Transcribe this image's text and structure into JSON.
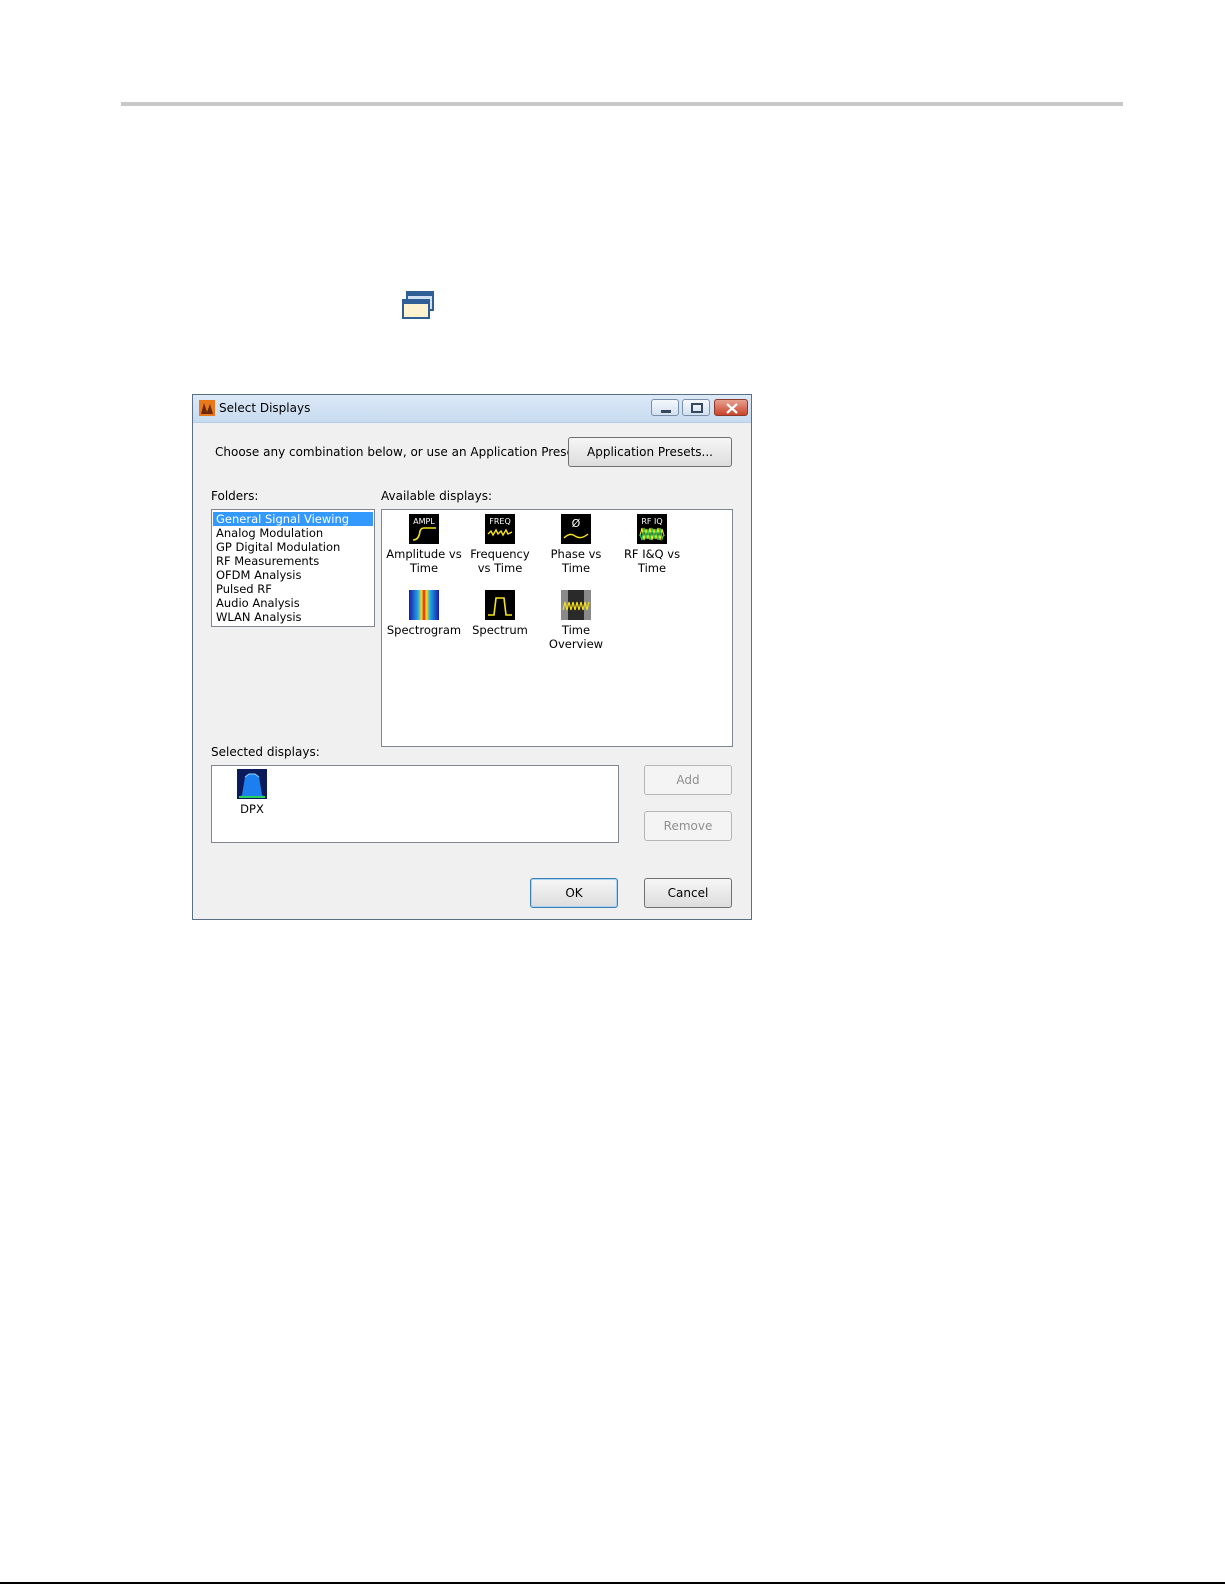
{
  "dialog": {
    "title": "Select Displays",
    "prompt": "Choose any combination below, or use an Application Preset.",
    "presets_button": "Application Presets...",
    "folders_label": "Folders:",
    "available_label": "Available displays:",
    "selected_label": "Selected displays:",
    "folders": [
      "General Signal Viewing",
      "Analog Modulation",
      "GP Digital Modulation",
      "RF Measurements",
      "OFDM Analysis",
      "Pulsed RF",
      "Audio Analysis",
      "WLAN Analysis"
    ],
    "selected_folder": "General Signal Viewing",
    "available_displays": [
      {
        "line1": "Amplitude vs",
        "line2": "Time",
        "icon": "ampl-icon",
        "icon_text": "AMPL"
      },
      {
        "line1": "Frequency",
        "line2": "vs Time",
        "icon": "freq-icon",
        "icon_text": "FREQ"
      },
      {
        "line1": "Phase vs",
        "line2": "Time",
        "icon": "phase-icon",
        "icon_text": "Ø"
      },
      {
        "line1": "RF I&Q vs",
        "line2": "Time",
        "icon": "rfiq-icon",
        "icon_text": "RF IQ"
      },
      {
        "line1": "Spectrogram",
        "line2": "",
        "icon": "spectrogram-icon",
        "icon_text": ""
      },
      {
        "line1": "Spectrum",
        "line2": "",
        "icon": "spectrum-icon",
        "icon_text": ""
      },
      {
        "line1": "Time",
        "line2": "Overview",
        "icon": "time-overview-icon",
        "icon_text": ""
      }
    ],
    "selected_displays": [
      {
        "label": "DPX",
        "icon": "dpx-icon"
      }
    ],
    "add_button": "Add",
    "remove_button": "Remove",
    "ok_button": "OK",
    "cancel_button": "Cancel"
  },
  "colors": {
    "selection": "#3399ff",
    "icon_bg": "#000000",
    "trace_yellow": "#f5e21a"
  }
}
